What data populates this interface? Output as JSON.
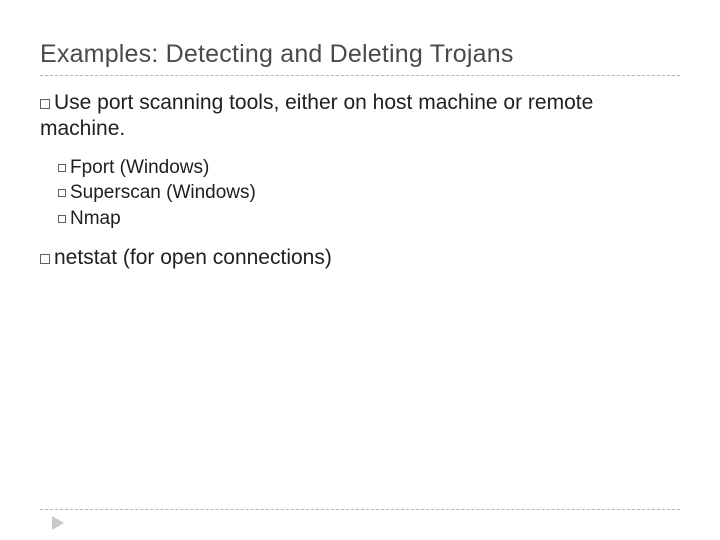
{
  "title": "Examples: Detecting and Deleting Trojans",
  "items": [
    {
      "text": "Use port scanning tools, either on host machine or remote machine.",
      "children": [
        {
          "text": "Fport (Windows)"
        },
        {
          "text": "Superscan (Windows)"
        },
        {
          "text": "Nmap"
        }
      ]
    },
    {
      "text": "netstat (for open connections)",
      "children": []
    }
  ],
  "footer_arrow_color": "#c9c9c9"
}
